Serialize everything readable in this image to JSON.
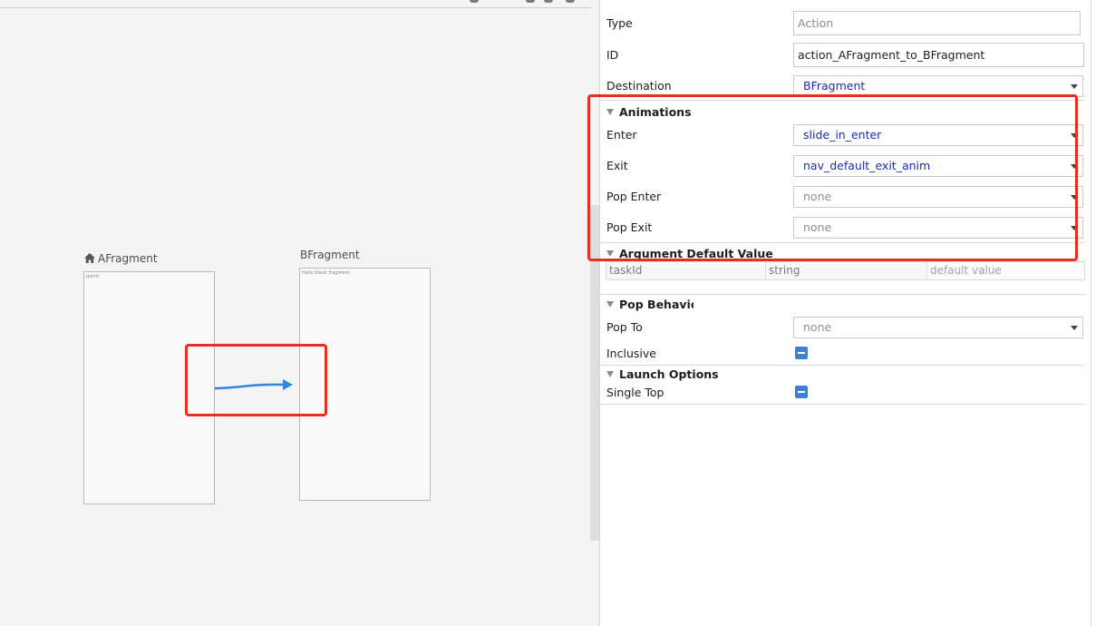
{
  "canvas": {
    "fragments": [
      {
        "name": "AFragment",
        "preview_text": "ipersf",
        "is_start": true
      },
      {
        "name": "BFragment",
        "preview_text": "Hello blank fragment",
        "is_start": false
      }
    ],
    "arrow_color": "#2f86e0",
    "highlight_color": "#e53020"
  },
  "attributes": {
    "type": {
      "label": "Type",
      "value": "Action"
    },
    "id": {
      "label": "ID",
      "value": "action_AFragment_to_BFragment"
    },
    "destination": {
      "label": "Destination",
      "value": "BFragment"
    },
    "animations": {
      "title": "Animations",
      "enter": {
        "label": "Enter",
        "value": "slide_in_enter"
      },
      "exit": {
        "label": "Exit",
        "value": "nav_default_exit_anim"
      },
      "pop_enter": {
        "label": "Pop Enter",
        "value": "none"
      },
      "pop_exit": {
        "label": "Pop Exit",
        "value": "none"
      }
    },
    "argument_default_value": {
      "title": "Argument Default Value",
      "columns": [
        "taskId",
        "string",
        "default value"
      ]
    },
    "pop_behavior": {
      "title": "Pop Behavior",
      "pop_to": {
        "label": "Pop To",
        "value": "none"
      },
      "inclusive": {
        "label": "Inclusive",
        "checked": "indeterminate"
      }
    },
    "launch_options": {
      "title": "Launch Options",
      "single_top": {
        "label": "Single Top",
        "checked": "indeterminate"
      }
    }
  },
  "colors": {
    "link_blue": "#1c2bb0",
    "checkbox_blue": "#3f7fcf"
  }
}
